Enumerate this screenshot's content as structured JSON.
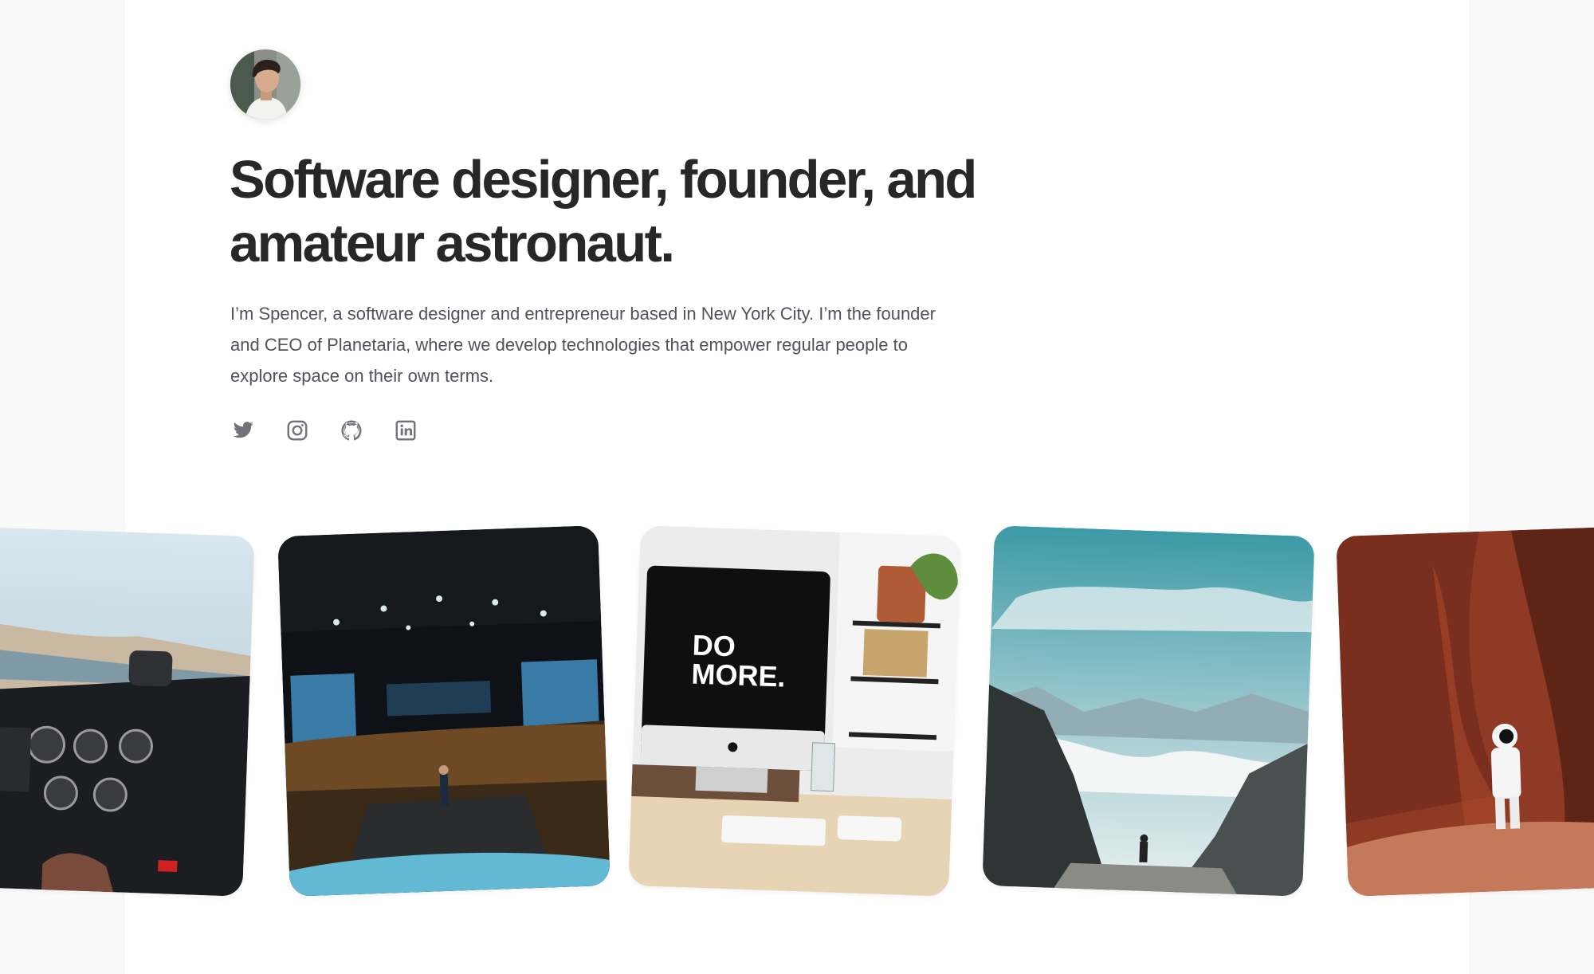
{
  "profile": {
    "avatar_icon": "portrait-avatar-icon",
    "headline_line1": "Software designer, founder, and",
    "headline_line2": "amateur astronaut.",
    "bio_line1": "I’m Spencer, a software designer and entrepreneur based in New York City. I’m the founder",
    "bio_line2": "and CEO of Planetaria, where we develop technologies that empower regular people to",
    "bio_line3": "explore space on their own terms."
  },
  "socials": [
    {
      "icon": "twitter-icon"
    },
    {
      "icon": "instagram-icon"
    },
    {
      "icon": "github-icon"
    },
    {
      "icon": "linkedin-icon"
    }
  ],
  "gallery": [
    {
      "icon": "airplane-cockpit-photo"
    },
    {
      "icon": "conference-stage-photo"
    },
    {
      "icon": "desk-computer-photo",
      "screen_text_line1": "DO",
      "screen_text_line2": "MORE."
    },
    {
      "icon": "mountain-hiker-photo"
    },
    {
      "icon": "astronaut-canyon-photo"
    }
  ],
  "colors": {
    "page_background": "#fafafa",
    "card_background": "#ffffff",
    "heading": "#27272a",
    "body_text": "#52525b",
    "icon": "#71717a"
  }
}
